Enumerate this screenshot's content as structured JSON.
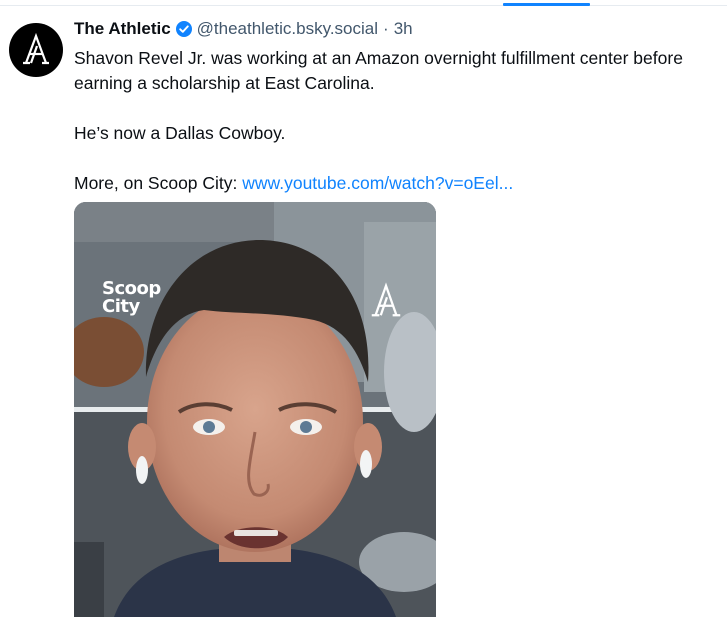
{
  "post": {
    "author": {
      "display_name": "The Athletic",
      "handle": "@theathletic.bsky.social",
      "verified": true,
      "avatar_icon": "athletic-logo-icon"
    },
    "separator": "·",
    "timestamp": "3h",
    "text": {
      "line1": "Shavon Revel Jr. was working at an Amazon overnight fulfillment center before earning a scholarship at East Carolina.",
      "line2": "He’s now a Dallas Cowboy.",
      "line3_prefix": "More, on Scoop City: ",
      "link": "www.youtube.com/watch?v=oEel..."
    },
    "media": {
      "overlay_logo": [
        "Scoop",
        "City"
      ],
      "overlay_mark_icon": "athletic-logo-icon"
    }
  },
  "colors": {
    "link": "#1083fe",
    "secondary_text": "#42576c",
    "verified_badge": "#1083fe",
    "tab_indicator": "#1083fe"
  }
}
